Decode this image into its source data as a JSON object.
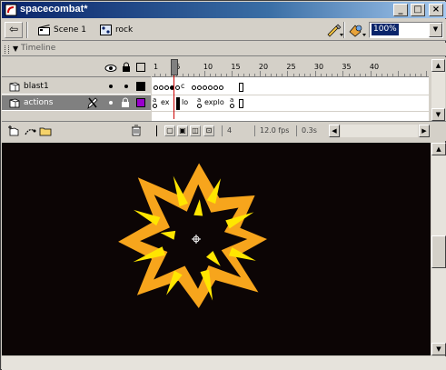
{
  "window": {
    "title": "spacecombat*"
  },
  "scene_bar": {
    "scene_label": "Scene 1",
    "symbol_label": "rock",
    "zoom_value": "100%"
  },
  "timeline": {
    "panel_label": "Timeline",
    "ruler_numbers": [
      "1",
      "5",
      "10",
      "15",
      "20",
      "25",
      "30",
      "35",
      "40"
    ],
    "layers": [
      {
        "name": "blast1",
        "selected": false
      },
      {
        "name": "actions",
        "selected": true
      }
    ],
    "frame_labels": [
      "ex",
      "lo",
      "c",
      "explo"
    ],
    "current_frame": "4",
    "frame_rate": "12.0 fps",
    "elapsed_time": "0.3s"
  },
  "colors": {
    "stage": "#0c0505",
    "explosion_outer": "#f7a51c",
    "explosion_inner": "#ffe600",
    "title_gradient_start": "#0a246a",
    "layer_selected": "#808080",
    "actions_layer_color": "#9900cc"
  }
}
